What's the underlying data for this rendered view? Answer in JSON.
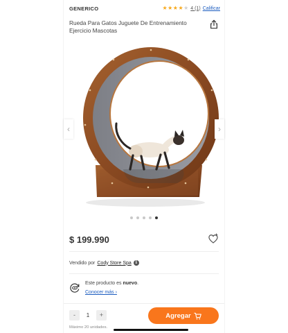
{
  "product": {
    "brand": "GENERICO",
    "title": "Rueda Para Gatos Juguete De Entrenamiento Ejercicio Mascotas",
    "price": "$ 199.990"
  },
  "rating": {
    "value": 4,
    "max": 5,
    "count_label": "4 (1)",
    "rate_label": "Calificar"
  },
  "icons": {
    "share": "share-icon",
    "favorite": "heart-icon",
    "prev": "chevron-left-icon",
    "next": "chevron-right-icon",
    "info": "info-icon",
    "condition": "refresh-eye-icon",
    "cart": "cart-icon"
  },
  "gallery": {
    "current": 5,
    "total": 5,
    "prev_label": "‹",
    "next_label": "›"
  },
  "seller": {
    "prefix": "Vendido por",
    "name": "Cody Store Spa",
    "info_label": "i"
  },
  "condition": {
    "text_prefix": "Este producto es",
    "text_value": "nuevo",
    "more_label": "Conocer más ›"
  },
  "cart": {
    "decrement_label": "-",
    "quantity": "1",
    "increment_label": "+",
    "max_units_label": "Máximo 20 unidades.",
    "add_label": "Agregar"
  },
  "colors": {
    "accent": "#f9761c",
    "link": "#1a5bbf",
    "star": "#f7a81b",
    "wood": "#8a4a22"
  }
}
